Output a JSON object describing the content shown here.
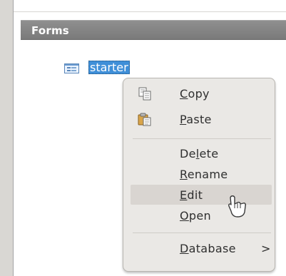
{
  "panel": {
    "title": "Forms"
  },
  "tree": {
    "item_name": "starter",
    "item_icon": "form-document-icon"
  },
  "context_menu": {
    "items": [
      {
        "id": "copy",
        "mnemonic": "C",
        "rest": "opy",
        "label": "Copy",
        "icon": "copy-icon"
      },
      {
        "id": "paste",
        "mnemonic": "P",
        "rest": "aste",
        "label": "Paste",
        "icon": "paste-icon"
      },
      {
        "id": "delete",
        "prefix": "De",
        "mnemonic": "l",
        "rest": "ete",
        "label": "Delete"
      },
      {
        "id": "rename",
        "mnemonic": "R",
        "rest": "ename",
        "label": "Rename"
      },
      {
        "id": "edit",
        "mnemonic": "E",
        "rest": "dit",
        "label": "Edit",
        "highlighted": true
      },
      {
        "id": "open",
        "mnemonic": "O",
        "rest": "pen",
        "label": "Open"
      },
      {
        "id": "database",
        "mnemonic": "D",
        "rest": "atabase",
        "label": "Database",
        "submenu_arrow": ">"
      }
    ]
  },
  "colors": {
    "selection_bg": "#3f8fd8",
    "menu_bg": "#eae8e5",
    "menu_highlight": "#d9d5d1",
    "header_bg": "#808080"
  },
  "pointer": {
    "icon": "mouse-pointer-icon"
  }
}
